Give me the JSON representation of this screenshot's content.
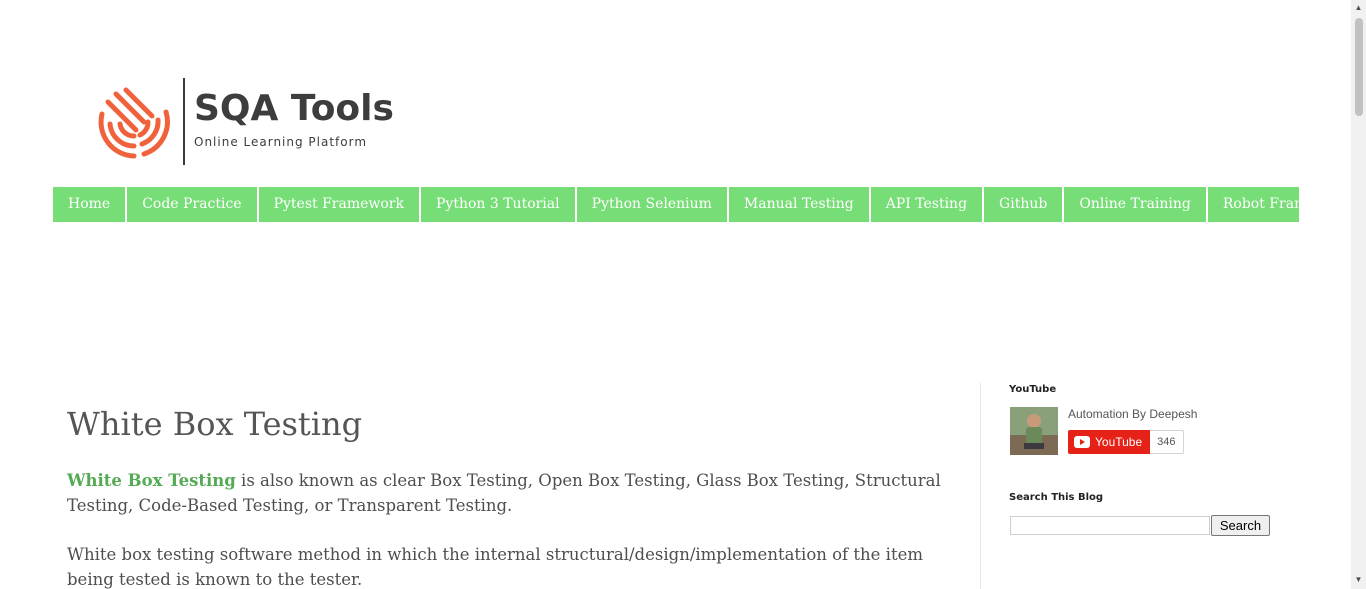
{
  "header": {
    "brand": "SQA Tools",
    "tagline": "Online Learning Platform",
    "logo_icon": "fingerprint-icon",
    "accent_color": "#f0623c"
  },
  "nav": {
    "background": "#77dd77",
    "items": [
      {
        "label": "Home"
      },
      {
        "label": "Code Practice"
      },
      {
        "label": "Pytest Framework"
      },
      {
        "label": "Python 3 Tutorial"
      },
      {
        "label": "Python Selenium"
      },
      {
        "label": "Manual Testing"
      },
      {
        "label": "API Testing"
      },
      {
        "label": "Github"
      },
      {
        "label": "Online Training"
      },
      {
        "label": "Robot Framework"
      }
    ]
  },
  "post": {
    "title": "White Box Testing",
    "highlight": "White Box Testing",
    "para1_rest": " is also known as clear Box Testing, Open Box Testing, Glass Box Testing, Structural Testing, Code-Based Testing, or Transparent Testing.",
    "para2": "White box testing software method in which the internal structural/design/implementation of the item being tested is known to the tester."
  },
  "sidebar": {
    "youtube": {
      "title": "YouTube",
      "channel_name": "Automation By Deepesh",
      "button_label": "YouTube",
      "subscriber_count": "346"
    },
    "search": {
      "title": "Search This Blog",
      "input_value": "",
      "button_label": "Search"
    }
  }
}
